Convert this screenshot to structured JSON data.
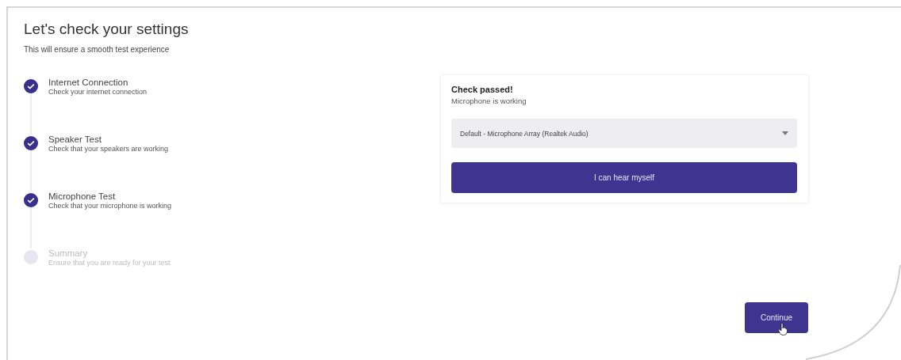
{
  "title": "Let's check your settings",
  "subtitle": "This will ensure a smooth test experience",
  "steps": [
    {
      "label": "Internet Connection",
      "description": "Check your internet connection",
      "done": true
    },
    {
      "label": "Speaker Test",
      "description": "Check that your speakers are working",
      "done": true
    },
    {
      "label": "Microphone Test",
      "description": "Check that your microphone is working",
      "done": true
    },
    {
      "label": "Summary",
      "description": "Ensure that you are ready for your test",
      "done": false
    }
  ],
  "card": {
    "title": "Check passed!",
    "message": "Microphone is working",
    "device_select": {
      "value": "Default - Microphone Array (Realtek Audio)"
    },
    "button": "I can hear myself"
  },
  "continue_button": "Continue"
}
